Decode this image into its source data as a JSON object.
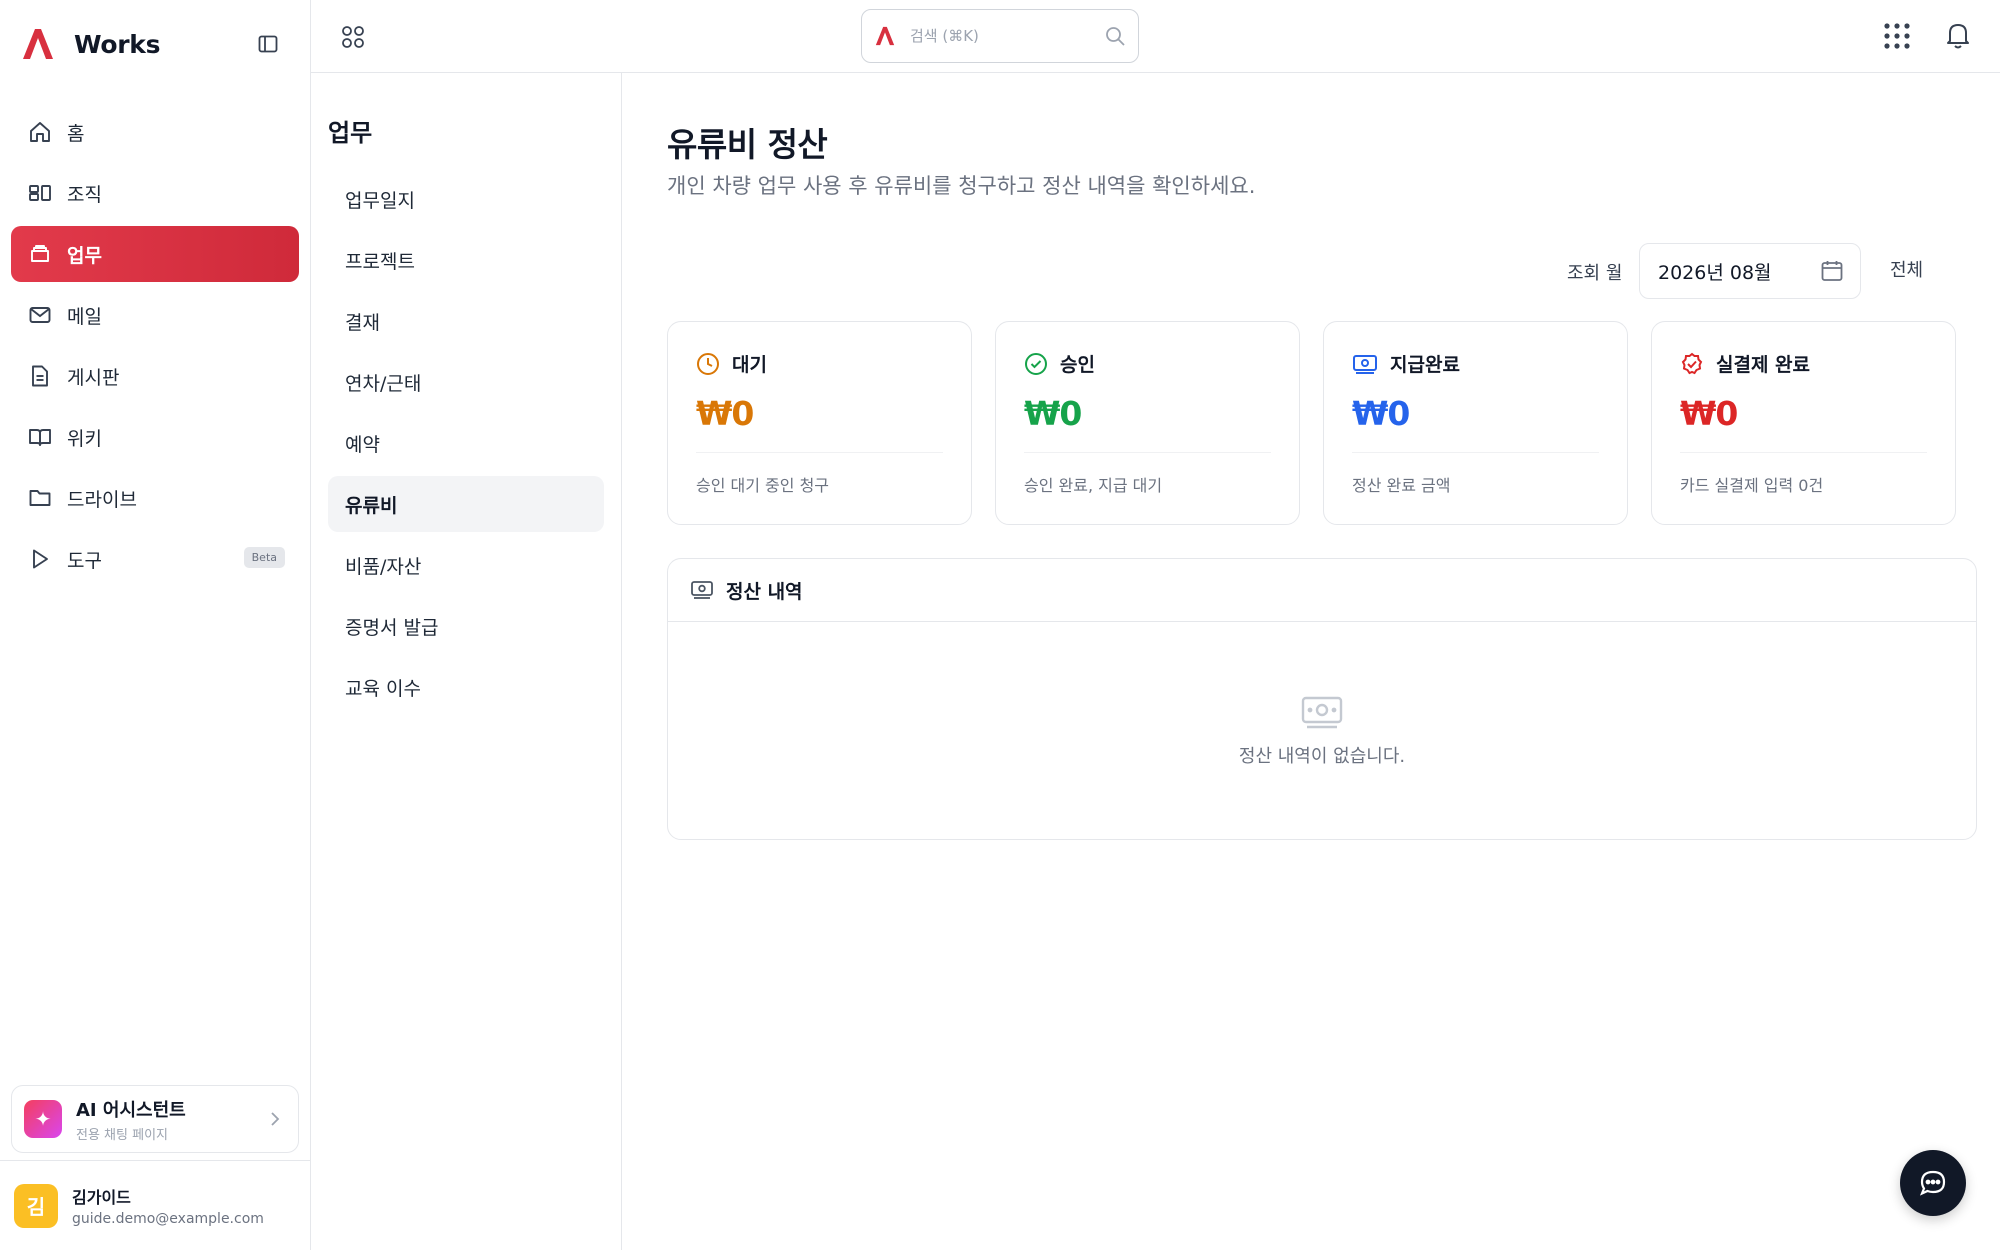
{
  "brand": {
    "name": "Works"
  },
  "colors": {
    "accent": "#d8303f",
    "pending": "#d97706",
    "approved": "#16a34a",
    "paid": "#2563eb",
    "settled": "#dc2626"
  },
  "sidebar": {
    "items": [
      {
        "label": "홈",
        "icon": "home-icon"
      },
      {
        "label": "조직",
        "icon": "org-icon"
      },
      {
        "label": "업무",
        "icon": "work-icon",
        "active": true
      },
      {
        "label": "메일",
        "icon": "mail-icon"
      },
      {
        "label": "게시판",
        "icon": "board-icon"
      },
      {
        "label": "위키",
        "icon": "book-icon"
      },
      {
        "label": "드라이브",
        "icon": "folder-icon"
      },
      {
        "label": "도구",
        "icon": "play-icon",
        "badge": "Beta"
      }
    ],
    "ai_assistant": {
      "title": "AI 어시스턴트",
      "subtitle": "전용 채팅 페이지"
    },
    "user": {
      "initial": "김",
      "name": "김가이드",
      "email": "guide.demo@example.com"
    }
  },
  "topbar": {
    "search_placeholder": "검색 (⌘K)"
  },
  "subnav": {
    "title": "업무",
    "items": [
      {
        "label": "업무일지"
      },
      {
        "label": "프로젝트"
      },
      {
        "label": "결재"
      },
      {
        "label": "연차/근태"
      },
      {
        "label": "예약"
      },
      {
        "label": "유류비",
        "active": true
      },
      {
        "label": "비품/자산"
      },
      {
        "label": "증명서 발급"
      },
      {
        "label": "교육 이수"
      }
    ]
  },
  "main": {
    "title": "유류비 정산",
    "description": "개인 차량 업무 사용 후 유류비를 청구하고 정산 내역을 확인하세요.",
    "filter": {
      "label": "조회 월",
      "month": "2026년 08월",
      "all_label": "전체"
    },
    "cards": [
      {
        "label": "대기",
        "amount": "₩0",
        "sub": "승인 대기 중인 청구",
        "icon": "clock-icon"
      },
      {
        "label": "승인",
        "amount": "₩0",
        "sub": "승인 완료, 지급 대기",
        "icon": "check-circle-icon"
      },
      {
        "label": "지급완료",
        "amount": "₩0",
        "sub": "정산 완료 금액",
        "icon": "money-icon"
      },
      {
        "label": "실결제 완료",
        "amount": "₩0",
        "sub": "카드 실결제 입력 0건",
        "icon": "badge-check-icon"
      }
    ],
    "history": {
      "title": "정산 내역",
      "empty_text": "정산 내역이 없습니다."
    }
  }
}
